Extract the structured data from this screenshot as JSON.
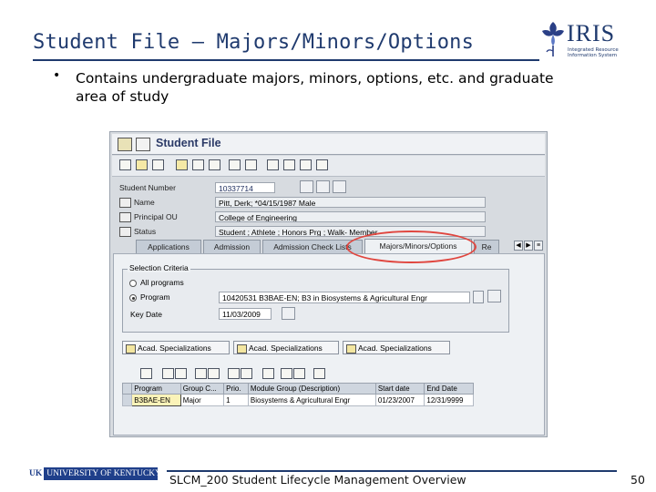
{
  "slide": {
    "title": "Student File – Majors/Minors/Options",
    "bullet": "Contains undergraduate majors, minors, options, etc. and graduate area of study"
  },
  "logo": {
    "name": "IRIS",
    "subtitle": "Integrated Resource Information System"
  },
  "sap": {
    "window_title": "Student File",
    "header": {
      "student_number_label": "Student Number",
      "student_number_value": "10337714",
      "name_label": "Name",
      "name_value": "Pitt, Derk; *04/15/1987 Male",
      "principal_ou_label": "Principal OU",
      "principal_ou_value": "College of Engineering",
      "status_label": "Status",
      "status_value": "Student ; Athlete ; Honors Prg ; Walk- Member"
    },
    "tabs": [
      "Applications",
      "Admission",
      "Admission Check Lists",
      "Majors/Minors/Options",
      "Re"
    ],
    "selection": {
      "legend": "Selection Criteria",
      "all_programs": "All programs",
      "program_label": "Program",
      "program_value": "10420531 B3BAE-EN; B3 in Biosystems & Agricultural Engr",
      "key_date_label": "Key Date",
      "key_date_value": "11/03/2009"
    },
    "action_buttons": [
      "Acad. Specializations",
      "Acad. Specializations",
      "Acad. Specializations"
    ],
    "grid": {
      "columns": [
        "Program",
        "Group C...",
        "Prio.",
        "Module Group (Description)",
        "Start date",
        "End Date"
      ],
      "rows": [
        [
          "B3BAE-EN",
          "Major",
          "1",
          "Biosystems & Agricultural Engr",
          "01/23/2007",
          "12/31/9999"
        ]
      ]
    }
  },
  "footer": {
    "university": "UNIVERSITY OF KENTUCKY",
    "uk_mark": "UK",
    "text": "SLCM_200 Student Lifecycle Management Overview",
    "page": "50"
  },
  "colors": {
    "title_blue": "#1f3a6e",
    "highlight_ellipse": "#e0463f",
    "selected_cell": "#fbf3b8"
  }
}
